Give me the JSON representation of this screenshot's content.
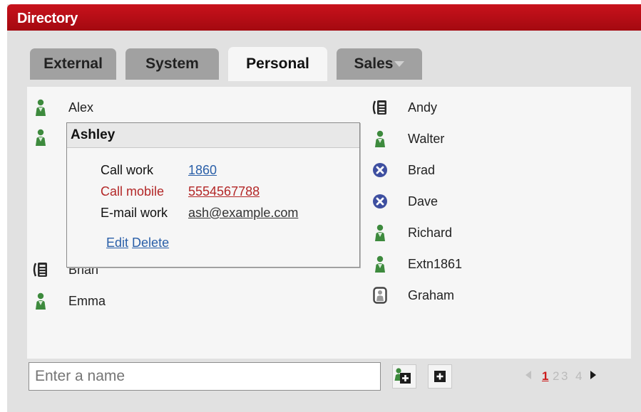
{
  "window": {
    "title": "Directory"
  },
  "tabs": [
    {
      "label": "External"
    },
    {
      "label": "System"
    },
    {
      "label": "Personal",
      "active": true
    },
    {
      "label": "Sales",
      "has_dropdown": true
    }
  ],
  "contacts_left": [
    {
      "name": "Alex",
      "icon": "person-icon"
    },
    {
      "name": "Ashley",
      "icon": "person-icon"
    },
    {
      "name": "Brian",
      "icon": "phone-icon"
    },
    {
      "name": "Emma",
      "icon": "person-icon"
    }
  ],
  "contacts_right": [
    {
      "name": "Andy",
      "icon": "phone-icon"
    },
    {
      "name": "Walter",
      "icon": "person-icon"
    },
    {
      "name": "Brad",
      "icon": "busy-icon"
    },
    {
      "name": "Dave",
      "icon": "busy-icon"
    },
    {
      "name": "Richard",
      "icon": "person-icon"
    },
    {
      "name": "Extn1861",
      "icon": "person-icon"
    },
    {
      "name": "Graham",
      "icon": "offline-person-icon"
    }
  ],
  "popup": {
    "name": "Ashley",
    "rows": [
      {
        "label": "Call work",
        "value": "1860"
      },
      {
        "label": "Call mobile",
        "value": "5554567788"
      },
      {
        "label": "E-mail work",
        "value": "ash@example.com"
      }
    ],
    "edit_label": "Edit",
    "delete_label": "Delete"
  },
  "search": {
    "placeholder": "Enter a name",
    "value": ""
  },
  "pager": {
    "pages": [
      "1",
      "2",
      "3",
      "4"
    ],
    "current": "1"
  },
  "colors": {
    "titlebar": "#b50c14",
    "tab_inactive": "#a1a1a1",
    "tab_active": "#f6f6f6",
    "link": "#2a5fa8",
    "mobile_link": "#b32727",
    "present": "#3d8a3d",
    "busy": "#3e4fa0",
    "pager_current": "#cc1b1b"
  }
}
